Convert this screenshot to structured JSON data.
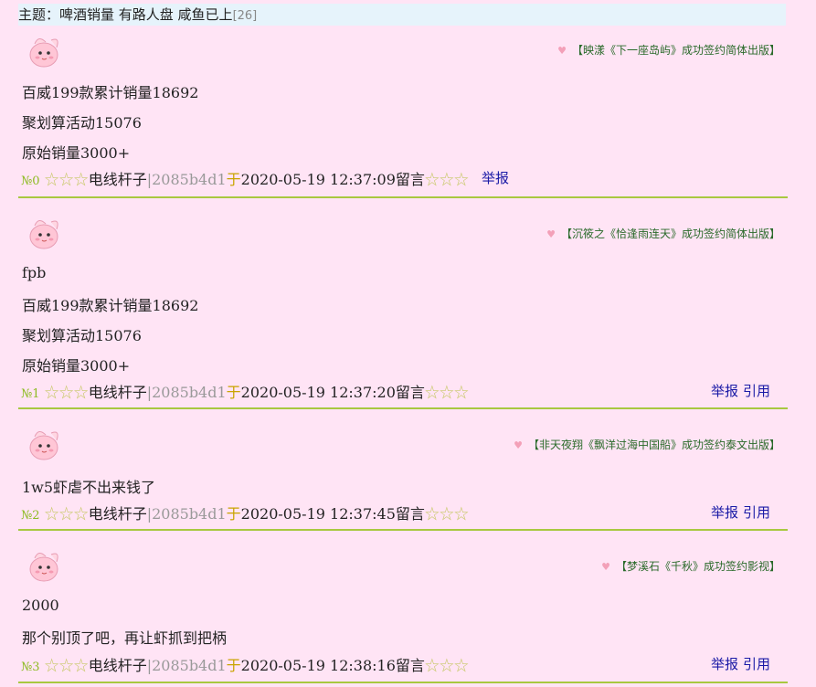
{
  "topic": {
    "prefix": "主题：",
    "title": "啤酒销量 有路人盘 咸鱼已上",
    "count": "[26]"
  },
  "posts": [
    {
      "sig": "【映漾《下一座岛屿》成功签约简体出版】",
      "lines": [
        "百威199款累计销量18692",
        "聚划算活动15076",
        "原始销量3000+"
      ],
      "no": "№0",
      "stars": "☆☆☆",
      "user": "电线杆子",
      "hash": "|2085b4d1",
      "yu": "于",
      "time": "2020-05-19 12:37:09",
      "liuyan": "留言",
      "report": "举报",
      "quote": ""
    },
    {
      "sig": "【沉筱之《恰逢雨连天》成功签约简体出版】",
      "lines": [
        "fpb",
        "百威199款累计销量18692",
        "聚划算活动15076",
        "原始销量3000+"
      ],
      "no": "№1",
      "stars": "☆☆☆",
      "user": "电线杆子",
      "hash": "|2085b4d1",
      "yu": "于",
      "time": "2020-05-19 12:37:20",
      "liuyan": "留言",
      "report": "举报",
      "quote": "引用"
    },
    {
      "sig": "【非天夜翔《飘洋过海中国船》成功签约泰文出版】",
      "lines": [
        "1w5虾虐不出来钱了"
      ],
      "no": "№2",
      "stars": "☆☆☆",
      "user": "电线杆子",
      "hash": "|2085b4d1",
      "yu": "于",
      "time": "2020-05-19 12:37:45",
      "liuyan": "留言",
      "report": "举报",
      "quote": "引用"
    },
    {
      "sig": "【梦溪石《千秋》成功签约影视】",
      "lines": [
        "2000",
        "那个别顶了吧，再让虾抓到把柄"
      ],
      "no": "№3",
      "stars": "☆☆☆",
      "user": "电线杆子",
      "hash": "|2085b4d1",
      "yu": "于",
      "time": "2020-05-19 12:38:16",
      "liuyan": "留言",
      "report": "举报",
      "quote": "引用"
    }
  ],
  "icons": {
    "avatar": "pink-puff-avatar-icon",
    "heart": "heart-icon"
  },
  "colors": {
    "background": "#ffe4f5",
    "topic_bg": "#e6f3fb",
    "divider": "#a8c840",
    "link": "#1a1aa6",
    "signature": "#2a6a2a"
  }
}
